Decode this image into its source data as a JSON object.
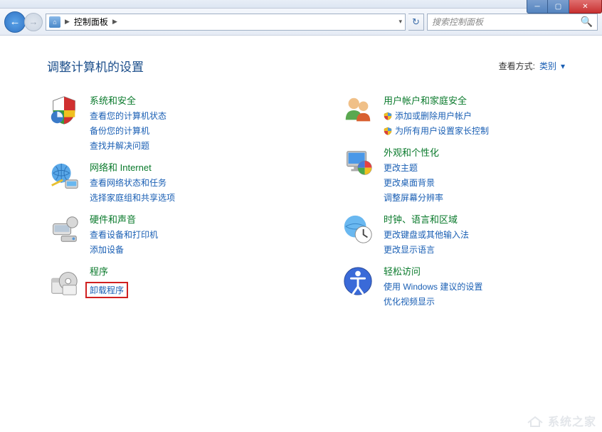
{
  "window": {
    "breadcrumb_sep": "▶",
    "breadcrumb_label": "控制面板",
    "search_placeholder": "搜索控制面板"
  },
  "header": {
    "page_title": "调整计算机的设置",
    "view_by_label": "查看方式:",
    "view_by_value": "类别",
    "view_by_caret": "▾"
  },
  "categories": {
    "left": [
      {
        "title": "系统和安全",
        "links": [
          {
            "text": "查看您的计算机状态",
            "shield": false
          },
          {
            "text": "备份您的计算机",
            "shield": false
          },
          {
            "text": "查找并解决问题",
            "shield": false
          }
        ]
      },
      {
        "title": "网络和 Internet",
        "links": [
          {
            "text": "查看网络状态和任务",
            "shield": false
          },
          {
            "text": "选择家庭组和共享选项",
            "shield": false
          }
        ]
      },
      {
        "title": "硬件和声音",
        "links": [
          {
            "text": "查看设备和打印机",
            "shield": false
          },
          {
            "text": "添加设备",
            "shield": false
          }
        ]
      },
      {
        "title": "程序",
        "links": [
          {
            "text": "卸载程序",
            "shield": false,
            "highlight": true
          }
        ]
      }
    ],
    "right": [
      {
        "title": "用户帐户和家庭安全",
        "links": [
          {
            "text": "添加或删除用户帐户",
            "shield": true
          },
          {
            "text": "为所有用户设置家长控制",
            "shield": true
          }
        ]
      },
      {
        "title": "外观和个性化",
        "links": [
          {
            "text": "更改主题",
            "shield": false
          },
          {
            "text": "更改桌面背景",
            "shield": false
          },
          {
            "text": "调整屏幕分辨率",
            "shield": false
          }
        ]
      },
      {
        "title": "时钟、语言和区域",
        "links": [
          {
            "text": "更改键盘或其他输入法",
            "shield": false
          },
          {
            "text": "更改显示语言",
            "shield": false
          }
        ]
      },
      {
        "title": "轻松访问",
        "links": [
          {
            "text": "使用 Windows 建议的设置",
            "shield": false
          },
          {
            "text": "优化视频显示",
            "shield": false
          }
        ]
      }
    ]
  },
  "watermark": "系统之家"
}
